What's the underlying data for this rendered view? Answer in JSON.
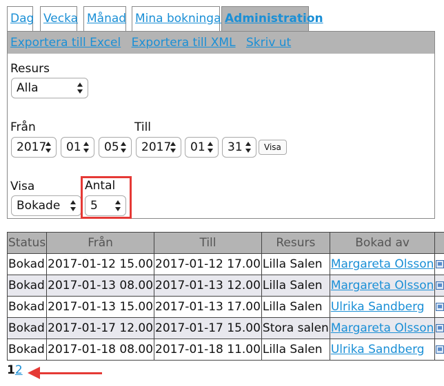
{
  "tabs": [
    {
      "label": "Dag"
    },
    {
      "label": "Vecka"
    },
    {
      "label": "Månad"
    },
    {
      "label": "Mina bokningar"
    },
    {
      "label": "Administration"
    }
  ],
  "toolbar": {
    "export_excel": "Exportera till Excel",
    "export_xml": "Exportera till XML",
    "print": "Skriv ut"
  },
  "filters": {
    "resurs_label": "Resurs",
    "resurs_value": "Alla",
    "fran_label": "Från",
    "fran_year": "2017",
    "fran_month": "01",
    "fran_day": "05",
    "till_label": "Till",
    "till_year": "2017",
    "till_month": "01",
    "till_day": "31",
    "visa_button": "Visa",
    "visa_label": "Visa",
    "visa_value": "Bokade",
    "antal_label": "Antal",
    "antal_value": "5"
  },
  "table": {
    "headers": [
      "Status",
      "Från",
      "Till",
      "Resurs",
      "Bokad av",
      ""
    ],
    "rows": [
      {
        "status": "Bokad",
        "fran": "2017-01-12 15.00",
        "till": "2017-01-12 17.00",
        "resurs": "Lilla Salen",
        "bokad_av": "Margareta Olsson"
      },
      {
        "status": "Bokad",
        "fran": "2017-01-13 08.00",
        "till": "2017-01-13 12.00",
        "resurs": "Lilla Salen",
        "bokad_av": "Margareta Olsson"
      },
      {
        "status": "Bokad",
        "fran": "2017-01-13 15.00",
        "till": "2017-01-13 17.00",
        "resurs": "Lilla Salen",
        "bokad_av": "Ulrika Sandberg"
      },
      {
        "status": "Bokad",
        "fran": "2017-01-17 12.00",
        "till": "2017-01-17 15.00",
        "resurs": "Stora salen",
        "bokad_av": "Margareta Olsson"
      },
      {
        "status": "Bokad",
        "fran": "2017-01-18 08.00",
        "till": "2017-01-18 11.00",
        "resurs": "Lilla Salen",
        "bokad_av": "Ulrika Sandberg"
      }
    ]
  },
  "pager": {
    "current": "1",
    "next": "2"
  },
  "colors": {
    "link": "#1a8fd6",
    "header_bg": "#b4b4b4",
    "highlight": "#e53935"
  }
}
